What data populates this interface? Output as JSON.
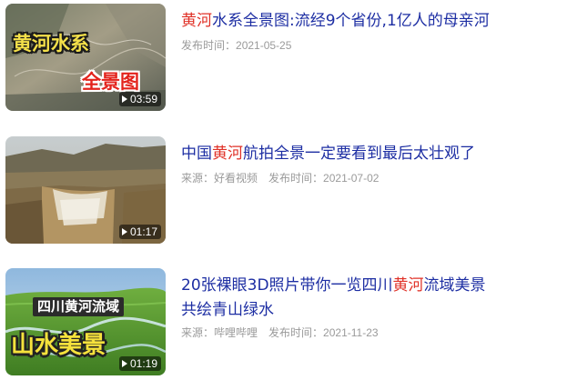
{
  "results": [
    {
      "thumb_overlay": [
        "黄河水系",
        "全景图"
      ],
      "duration": "03:59",
      "title_parts": [
        {
          "text": "黄河",
          "highlight": true
        },
        {
          "text": "水系全景图:流经9个省份,1亿人的母亲河",
          "highlight": false
        }
      ],
      "source_label": "",
      "source_value": "",
      "date_label": "发布时间：",
      "date": "2021-05-25"
    },
    {
      "thumb_overlay": [],
      "duration": "01:17",
      "title_parts": [
        {
          "text": "中国",
          "highlight": false
        },
        {
          "text": "黄河",
          "highlight": true
        },
        {
          "text": "航拍全景一定要看到最后太壮观了",
          "highlight": false
        }
      ],
      "source_label": "来源：",
      "source_value": "好看视频",
      "date_label": "发布时间：",
      "date": "2021-07-02"
    },
    {
      "thumb_overlay": [
        "四川黄河流域",
        "山水美景"
      ],
      "duration": "01:19",
      "title_parts": [
        {
          "text": "20张裸眼3D照片带你一览四川",
          "highlight": false
        },
        {
          "text": "黄河",
          "highlight": true
        },
        {
          "text": "流域美景",
          "highlight": false
        },
        {
          "text": "共绘青山绿水",
          "highlight": false
        }
      ],
      "source_label": "来源：",
      "source_value": "哔哩哔哩",
      "date_label": "发布时间：",
      "date": "2021-11-23"
    }
  ],
  "colors": {
    "title_link": "#1d2ea3",
    "keyword_highlight": "#e03127",
    "meta_text": "#9a9a9a"
  },
  "icons": {
    "duration": "play-icon"
  }
}
